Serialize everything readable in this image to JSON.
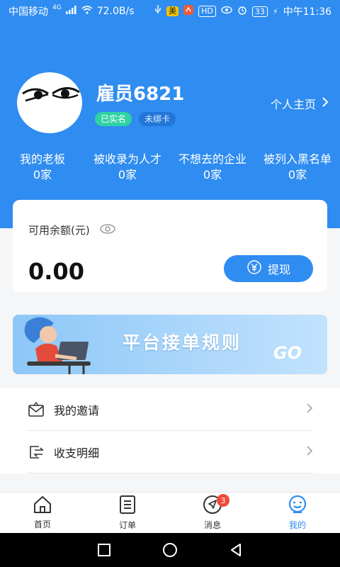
{
  "status_bar": {
    "carrier": "中国移动",
    "network": "4G",
    "speed": "72.0B/s",
    "app_badge": "美",
    "hd_badge": "HD",
    "battery": "33",
    "time": "中午11:36"
  },
  "profile": {
    "username": "雇员6821",
    "tag_verified": "已实名",
    "tag_card": "未绑卡",
    "home_link": "个人主页"
  },
  "stats": [
    {
      "label": "我的老板",
      "value": "0家"
    },
    {
      "label": "被收录为人才",
      "value": "0家"
    },
    {
      "label": "不想去的企业",
      "value": "0家"
    },
    {
      "label": "被列入黑名单",
      "value": "0家"
    }
  ],
  "balance": {
    "label": "可用余额(元)",
    "amount": "0.00",
    "withdraw_label": "提现"
  },
  "banner": {
    "title": "平台接单规则",
    "go": "GO"
  },
  "menu": [
    {
      "label": "我的邀请",
      "icon": "envelope-icon"
    },
    {
      "label": "收支明细",
      "icon": "transfer-icon"
    }
  ],
  "tabs": [
    {
      "label": "首页",
      "icon": "home-icon"
    },
    {
      "label": "订单",
      "icon": "order-icon"
    },
    {
      "label": "消息",
      "icon": "message-icon",
      "badge": "3"
    },
    {
      "label": "我的",
      "icon": "mine-icon",
      "active": true
    }
  ],
  "colors": {
    "primary": "#2f8cf0",
    "verified": "#2fd3a3",
    "badge": "#f04a3a"
  }
}
